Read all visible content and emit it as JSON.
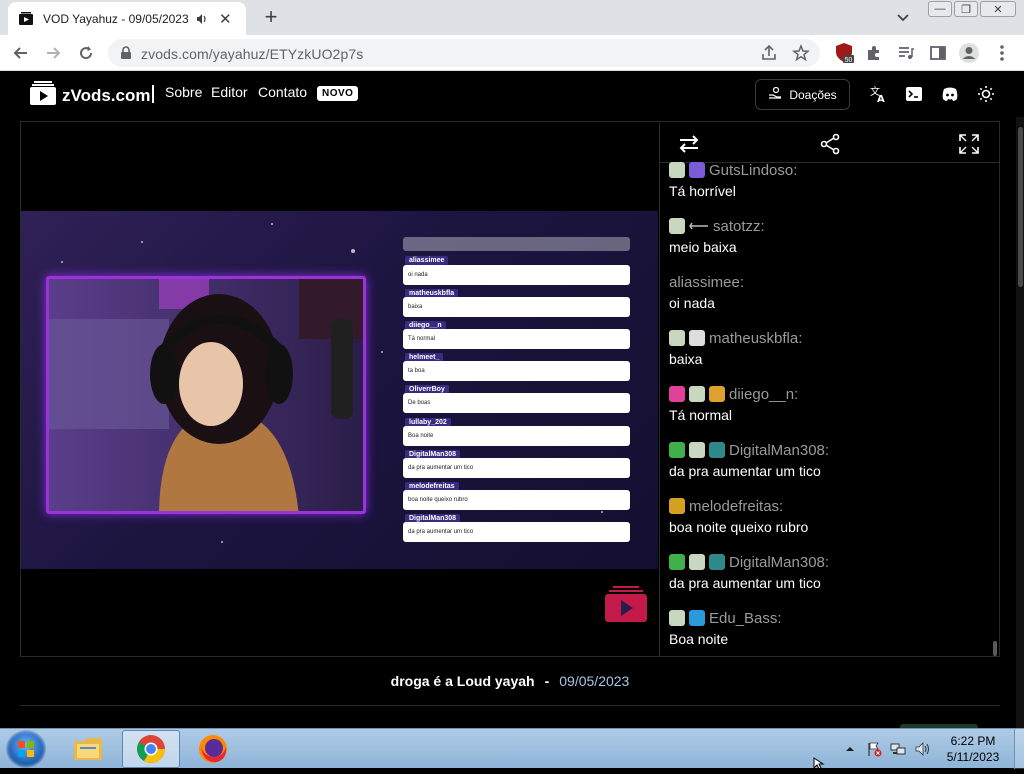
{
  "browser": {
    "tab_title": "VOD Yayahuz - 09/05/2023 |",
    "url": "zvods.com/yayahuz/ETYzkUO2p7s",
    "extension_badge": "50"
  },
  "site": {
    "logo_text": "zVods.com",
    "nav": [
      "Sobre",
      "Editor",
      "Contato"
    ],
    "new_badge": "NOVO",
    "donate_label": "Doações"
  },
  "overlay_chat": [
    {
      "user": "aliassimee",
      "msg": "oi nada"
    },
    {
      "user": "matheuskbfla",
      "msg": "baixa"
    },
    {
      "user": "diiego__n",
      "msg": "Tá normal"
    },
    {
      "user": "helmeet_",
      "msg": "ta boa"
    },
    {
      "user": "OliverrBoy",
      "msg": "De boas"
    },
    {
      "user": "lullaby_202",
      "msg": "Boa noite"
    },
    {
      "user": "DigitalMan308",
      "msg": "da pra aumentar um tico"
    },
    {
      "user": "melodefreitas",
      "msg": "boa noite queixo rubro"
    },
    {
      "user": "DigitalMan308",
      "msg": "da pra aumentar um tico"
    }
  ],
  "chat": [
    {
      "user": "GutsLindoso:",
      "text": "Tá horrível",
      "badges": [
        "#c8d8c0",
        "#7b5cd6"
      ]
    },
    {
      "user": "satotzz:",
      "text": "meio baixa",
      "badges": [
        "#c8d8c0"
      ]
    },
    {
      "user": "aliassimee:",
      "text": "oi nada",
      "badges": []
    },
    {
      "user": "matheuskbfla:",
      "text": "baixa",
      "badges": [
        "#c8d8c0",
        "#dddddd"
      ]
    },
    {
      "user": "diiego__n:",
      "text": "Tá normal",
      "badges": [
        "#e0409a",
        "#c8d8c0",
        "#e0a030"
      ]
    },
    {
      "user": "DigitalMan308:",
      "text": "da pra aumentar um tico",
      "badges": [
        "#3fb04a",
        "#c8d8c0",
        "#2e8a8a"
      ]
    },
    {
      "user": "melodefreitas:",
      "text": "boa noite queixo rubro",
      "badges": [
        "#d4a020"
      ]
    },
    {
      "user": "DigitalMan308:",
      "text": "da pra aumentar um tico",
      "badges": [
        "#3fb04a",
        "#c8d8c0",
        "#2e8a8a"
      ]
    },
    {
      "user": "Edu_Bass:",
      "text": "Boa noite",
      "badges": [
        "#c8d8c0",
        "#2a9ad8"
      ]
    }
  ],
  "video_info": {
    "title": "droga é a Loud yayah",
    "separator": "-",
    "date": "09/05/2023"
  },
  "taskbar": {
    "time": "6:22 PM",
    "date": "5/11/2023"
  },
  "colors": {
    "accent_purple": "#9b34d8",
    "date_blue": "#a8c4e8",
    "chat_user_gray": "#9a9a9a"
  }
}
